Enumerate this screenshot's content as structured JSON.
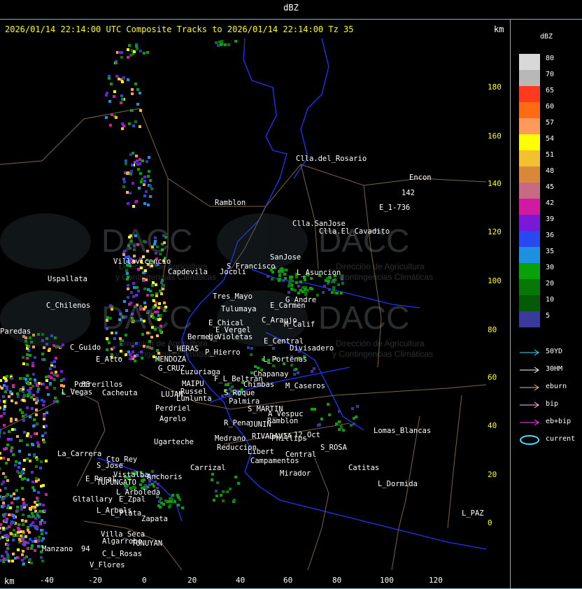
{
  "window": {
    "title": "dBZ"
  },
  "header": {
    "text": "2026/01/14 22:14:00 UTC Composite Tracks to 2026/01/14 22:14:00 Tz 35",
    "unit": "km"
  },
  "x_axis": {
    "unit": "km",
    "ticks": [
      "-40",
      "-20",
      "0",
      "20",
      "40",
      "60",
      "80",
      "100",
      "120"
    ]
  },
  "y_axis": {
    "ticks": [
      "180",
      "160",
      "140",
      "120",
      "100",
      "80",
      "60",
      "40",
      "20",
      "0"
    ]
  },
  "legend": {
    "title": "dBZ",
    "scale": [
      {
        "value": "80",
        "color": "#d8d8d8"
      },
      {
        "value": "70",
        "color": "#b8b8b8"
      },
      {
        "value": "65",
        "color": "#ff3a1e"
      },
      {
        "value": "60",
        "color": "#ff6a14"
      },
      {
        "value": "57",
        "color": "#ff9a5a"
      },
      {
        "value": "54",
        "color": "#ffff00"
      },
      {
        "value": "51",
        "color": "#f5c030"
      },
      {
        "value": "48",
        "color": "#d9883a"
      },
      {
        "value": "45",
        "color": "#c86a86"
      },
      {
        "value": "42",
        "color": "#d01aa0"
      },
      {
        "value": "39",
        "color": "#7a18d8"
      },
      {
        "value": "36",
        "color": "#2848f0"
      },
      {
        "value": "35",
        "color": "#1e90e0"
      },
      {
        "value": "30",
        "color": "#0aa00a"
      },
      {
        "value": "20",
        "color": "#067806"
      },
      {
        "value": "10",
        "color": "#055a05"
      },
      {
        "value": "5",
        "color": "#3a3a9c"
      }
    ],
    "tracks": [
      {
        "label": "50YD",
        "color": "#40e0ff"
      },
      {
        "label": "30HM",
        "color": "#ffffff"
      },
      {
        "label": "eburn",
        "color": "#f0c080"
      },
      {
        "label": "bip",
        "color": "#ffc0ff"
      },
      {
        "label": "eb+bip",
        "color": "#ff40ff"
      },
      {
        "label": "current",
        "color": "#40e0ff"
      }
    ]
  },
  "watermark": {
    "brand": "DACC",
    "line1": "Dirección de Agricultura",
    "line2": "y Contingencias Climáticas"
  },
  "places": [
    "Clla.del_Rosario",
    "Encon",
    "142",
    "E_1-736",
    "Ramblon",
    "Clla.SanJose",
    "Clla.El_Cavadito",
    "Villavicencio",
    "Capdevila",
    "S_Francisco",
    "SanJose",
    "L_Asuncion",
    "Uspallata",
    "Tres_Mayo",
    "Jocoli",
    "C_Chilenos",
    "Tulumaya",
    "E_Carmen",
    "G_Andre",
    "C_Araujo",
    "M_Calif",
    "E_Chical",
    "E_Vergel",
    "Paredas",
    "Bermejo",
    "L_Violetas",
    "E_Central",
    "Divisadero",
    "C_Guido",
    "L_HERAS",
    "P_Hierro",
    "E_Alto",
    "MENDOZA",
    "L_Portenas",
    "G_CRUZ",
    "Luzuriaga",
    "Chapanay",
    "F_L_Beltran",
    "Chimbas",
    "M_Caseros",
    "Potrerillos",
    "MAIPU",
    "Russel",
    "S_Roque",
    "L_Vegas",
    "Cacheuta",
    "LUJAN",
    "Lunlunta",
    "Palmira",
    "Perdriel",
    "S_MARTIN",
    "A_Vespuc",
    "Ramblon",
    "Agrelo",
    "R_Pena",
    "JUNIN",
    "Ugarteche",
    "Medrano",
    "RIVADAVIA",
    "Phillips",
    "12_Oct",
    "Lomas_Blancas",
    "S_ROSA",
    "La_Carrera",
    "Cto_Rey",
    "Reduccion",
    "Libert",
    "Campamentos",
    "Central",
    "S_Jose",
    "Carrizal",
    "Catitas",
    "E_Peral",
    "Vistalba",
    "Anchoris",
    "Mirador",
    "TUPUNGATO",
    "L_Dormida",
    "L_Arboleda",
    "Gltallary",
    "E_Zpal",
    "L_Arbols",
    "L_Plata",
    "Zapata",
    "L_PAZ",
    "Villa_Seca",
    "Algarrobo",
    "Manzano",
    "TUNUYAN",
    "C_L_Rosas",
    "V_Flores",
    "88",
    "94"
  ]
}
